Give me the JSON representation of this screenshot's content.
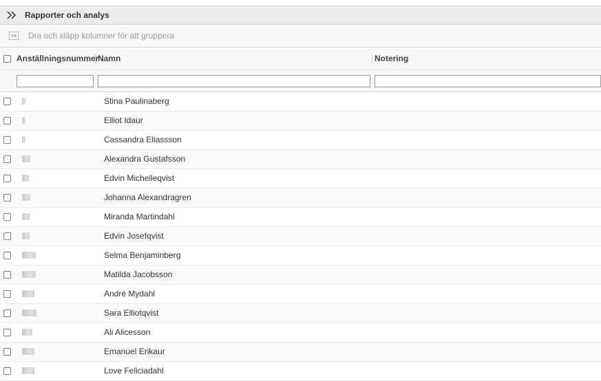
{
  "toolbar": {
    "title": "Rapporter och analys",
    "expand_icon": "double-chevron-right-icon"
  },
  "groupbar": {
    "hint": "Dra och släpp kolumner för att gruppera",
    "icon": "group-columns-icon"
  },
  "columns": [
    {
      "label": "Anställningsnummer"
    },
    {
      "label": "Namn"
    },
    {
      "label": "Notering"
    }
  ],
  "filters": {
    "anstallningsnummer": "",
    "namn": "",
    "notering": ""
  },
  "rows": [
    {
      "name": "Stina Paulinaberg"
    },
    {
      "name": "Elliot Idaur"
    },
    {
      "name": "Cassandra Eliassson"
    },
    {
      "name": "Alexandra Gustafsson"
    },
    {
      "name": "Edvin Michelleqvist"
    },
    {
      "name": "Johanna Alexandragren"
    },
    {
      "name": "Miranda Martindahl"
    },
    {
      "name": "Edvin Josefqvist"
    },
    {
      "name": "Selma Benjaminberg"
    },
    {
      "name": "Matilda Jacobsson"
    },
    {
      "name": "André Mydahl"
    },
    {
      "name": "Sara Elliotqvist"
    },
    {
      "name": "Ali Alicesson"
    },
    {
      "name": "Emanuel Erikaur"
    },
    {
      "name": "Love Feliciadahl"
    }
  ],
  "colors": {
    "toolbar_bg": "#ececec",
    "header_bg": "#f7f7f7",
    "alt_row": "#f8fafc"
  }
}
